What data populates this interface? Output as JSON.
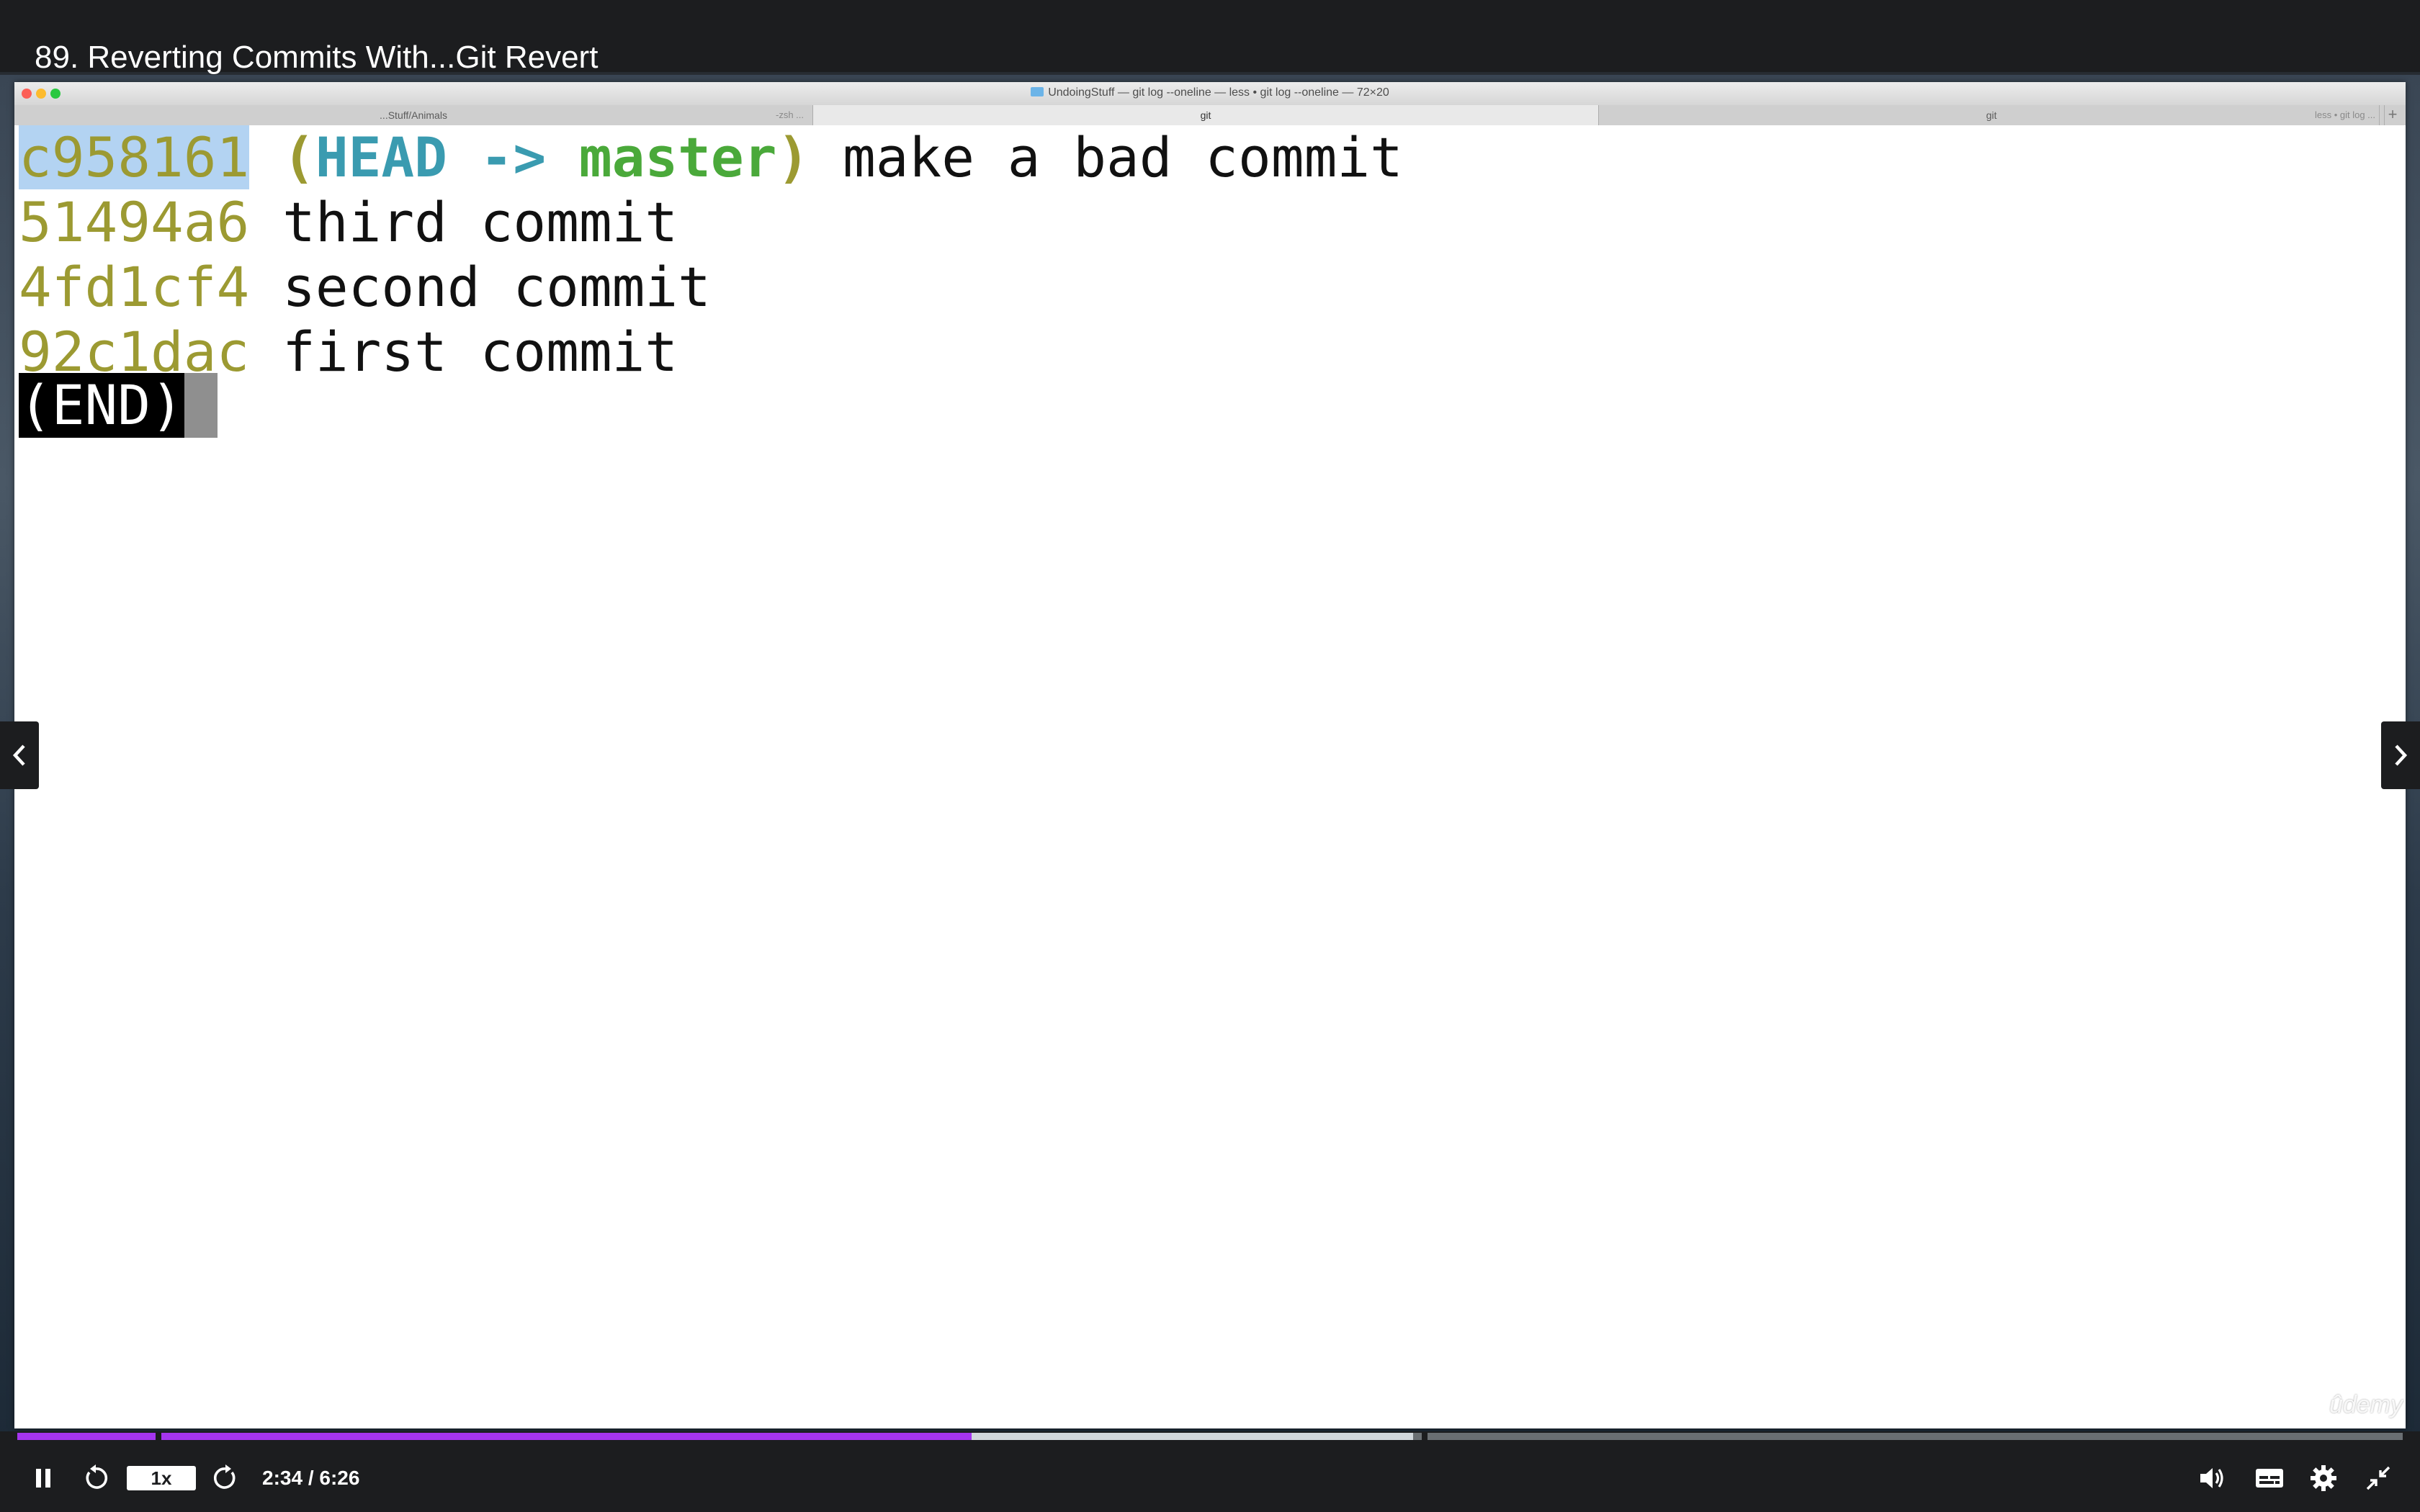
{
  "lecture": {
    "title": "89. Reverting Commits With...Git Revert"
  },
  "terminal_window": {
    "title": "UndoingStuff — git log --oneline — less • git log --oneline — 72×20",
    "tabs": [
      {
        "label": "...Stuff/Animals",
        "secondary": "-zsh ...",
        "active": false
      },
      {
        "label": "git",
        "active": true
      },
      {
        "label": "git",
        "active": false
      },
      {
        "label": "less • git log ...",
        "active": false
      }
    ],
    "new_tab_label": "+"
  },
  "git_log": {
    "entries": [
      {
        "hash": "c958161",
        "ref_open": "(",
        "head": "HEAD",
        "arrow": "->",
        "branch": "master",
        "ref_close": ")",
        "message": "make a bad commit",
        "selected": true
      },
      {
        "hash": "51494a6",
        "message": "third commit"
      },
      {
        "hash": "4fd1cf4",
        "message": "second commit"
      },
      {
        "hash": "92c1dac",
        "message": "first commit"
      }
    ],
    "end_marker": "(END)"
  },
  "player": {
    "time_display": "2:34 / 6:26",
    "current_time": "2:34",
    "duration": "6:26",
    "progress_fraction": 0.4,
    "buffered_fraction": 0.585,
    "playback_rate": "1x",
    "watermark": "ûdemy",
    "state": "playing"
  },
  "colors": {
    "progress": "#a435f0",
    "hash": "#9c9a32",
    "head_ref": "#3a9bb0",
    "branch_ref": "#4aa93a",
    "selection": "#b3d3f2"
  },
  "icons": {
    "play_pause": "pause-icon",
    "rewind": "rewind-5s-icon",
    "forward": "forward-5s-icon",
    "volume": "volume-icon",
    "captions": "captions-icon",
    "settings": "gear-icon",
    "fullscreen": "exit-fullscreen-icon",
    "prev": "chevron-left-icon",
    "next": "chevron-right-icon"
  }
}
